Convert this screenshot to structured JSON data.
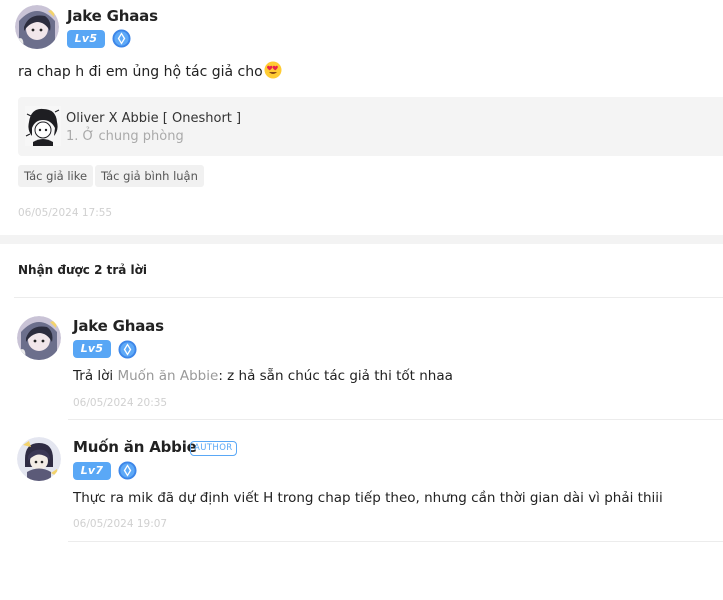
{
  "comment": {
    "username": "Jake Ghaas",
    "level": "Lv5",
    "rank_icon": "diamond-rank-icon",
    "text": "ra chap h đi em ủng hộ tác giả cho",
    "emoji": "heart-eyes-emoji",
    "story": {
      "title": "Oliver X Abbie [ Oneshort ]",
      "chapter": "1. Ở chung phòng"
    },
    "tags": [
      "Tác giả like",
      "Tác giả bình luận"
    ],
    "timestamp": "06/05/2024 17:55"
  },
  "replies_header": "Nhận được 2 trả lời",
  "replies": [
    {
      "username": "Jake Ghaas",
      "level": "Lv5",
      "prefix": "Trả lời",
      "mention": "Muốn ăn Abbie",
      "text": ": z hả sẵn chúc tác giả thi tốt nhaa",
      "timestamp": "06/05/2024 20:35"
    },
    {
      "username": "Muốn ăn Abbie",
      "author_badge": "AUTHOR",
      "level": "Lv7",
      "text": "Thực ra mik đã dự định viết H trong chap tiếp theo, nhưng cần thời gian dài vì phải thiii",
      "timestamp": "06/05/2024 19:07"
    }
  ],
  "colors": {
    "level_badge": "#58a6f5",
    "author_badge": "#5aa8f6",
    "mention": "#999999",
    "timestamp": "#d0d0d0"
  }
}
